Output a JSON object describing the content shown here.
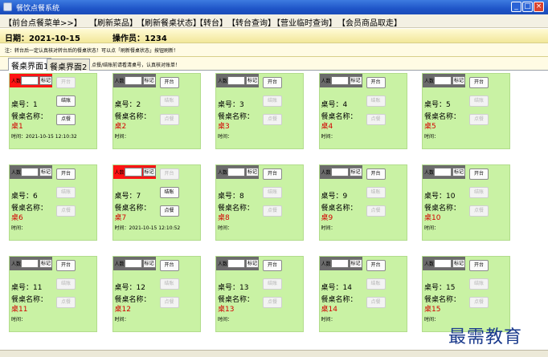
{
  "window": {
    "title": "餐饮点餐系统",
    "min_label": "_",
    "max_label": "□",
    "close_label": "×"
  },
  "menu": [
    "【前台点餐菜单>>】",
    "【刷新菜品】",
    "【刷新餐桌状态】",
    "【转台】",
    "【转台查询】",
    "【营业临时查询】",
    "【会员商品取走】"
  ],
  "info": {
    "date": "日期：2021-10-15",
    "operator": "操作员：1234"
  },
  "notice": "注：转台后一定认真核对转台后的餐桌状态！可以点「刷新餐桌状态」按钮刷新！",
  "tabs": {
    "items": [
      "餐桌界面1",
      "餐桌界面2"
    ],
    "active": 0,
    "hint": "点餐/结账前请看清桌号，认真核对账单！"
  },
  "card_labels": {
    "people": "人数",
    "mark": "标记",
    "open": "开台",
    "settle": "结账",
    "order": "点餐",
    "table_name": "餐桌名称："
  },
  "tables": [
    {
      "no": "桌号：1",
      "code": "桌1",
      "occupied": true,
      "time": "时间：2021-10-15 12:10:32"
    },
    {
      "no": "桌号：2",
      "code": "桌2",
      "occupied": false,
      "time": "时间："
    },
    {
      "no": "桌号：3",
      "code": "桌3",
      "occupied": false,
      "time": "时间："
    },
    {
      "no": "桌号：4",
      "code": "桌4",
      "occupied": false,
      "time": "时间："
    },
    {
      "no": "桌号：5",
      "code": "桌5",
      "occupied": false,
      "time": "时间："
    },
    {
      "no": "桌号：6",
      "code": "桌6",
      "occupied": false,
      "time": "时间："
    },
    {
      "no": "桌号：7",
      "code": "桌7",
      "occupied": true,
      "time": "时间：2021-10-15 12:10:52"
    },
    {
      "no": "桌号：8",
      "code": "桌8",
      "occupied": false,
      "time": "时间："
    },
    {
      "no": "桌号：9",
      "code": "桌9",
      "occupied": false,
      "time": "时间："
    },
    {
      "no": "桌号：10",
      "code": "桌10",
      "occupied": false,
      "time": "时间："
    },
    {
      "no": "桌号：11",
      "code": "桌11",
      "occupied": false,
      "time": "时间："
    },
    {
      "no": "桌号：12",
      "code": "桌12",
      "occupied": false,
      "time": "时间："
    },
    {
      "no": "桌号：13",
      "code": "桌13",
      "occupied": false,
      "time": "时间："
    },
    {
      "no": "桌号：14",
      "code": "桌14",
      "occupied": false,
      "time": "时间："
    },
    {
      "no": "桌号：15",
      "code": "桌15",
      "occupied": false,
      "time": "时间："
    }
  ],
  "watermark": "最需教育",
  "colors": {
    "card_bg": "#c9f2a4",
    "occupied_header": "#ff1414",
    "free_header": "#6b6b6b",
    "table_code": "#d40000",
    "titlebar": "#1f55c8"
  }
}
